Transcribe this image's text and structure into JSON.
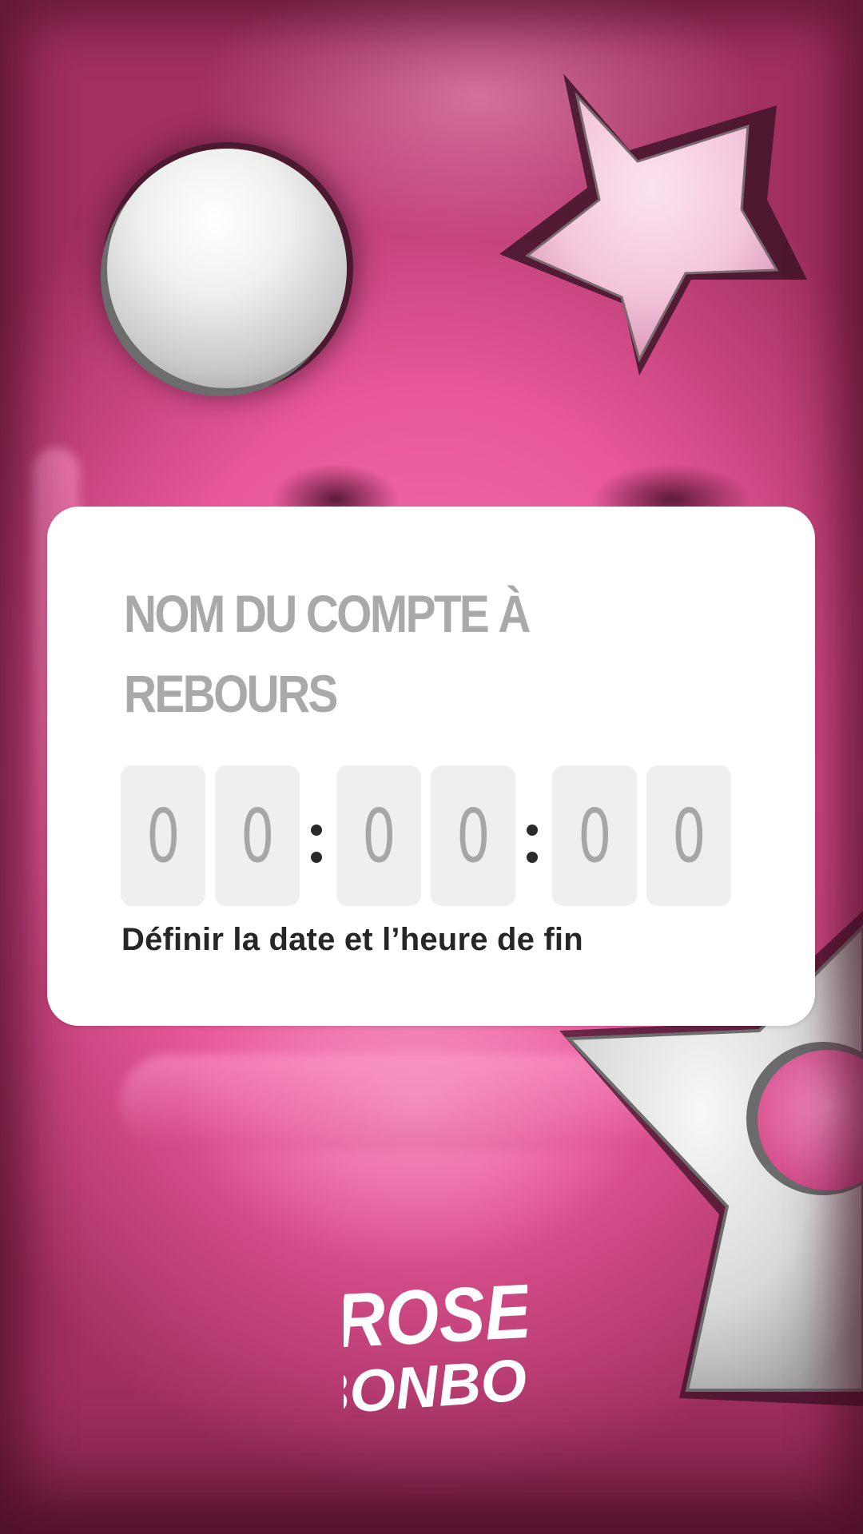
{
  "countdown": {
    "title": "NOM DU COMPTE À REBOURS",
    "digits": [
      "0",
      "0",
      "0",
      "0",
      "0",
      "0"
    ],
    "separator": ":",
    "set_end_label": "Définir la date et l’heure de fin"
  },
  "brand": {
    "line1": "ROSE",
    "line2": "BONBON",
    "color": "#ffffff"
  },
  "colors": {
    "background_pink": "#e8579a",
    "card": "#ffffff",
    "digit_tile": "#efefef"
  }
}
